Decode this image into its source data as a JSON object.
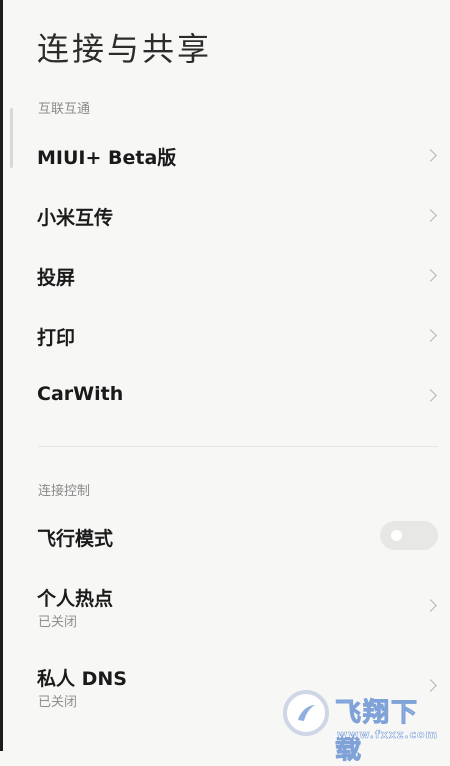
{
  "page": {
    "title": "连接与共享"
  },
  "sections": [
    {
      "header": "互联互通",
      "items": [
        {
          "label": "MIUI+ Beta版"
        },
        {
          "label": "小米互传"
        },
        {
          "label": "投屏"
        },
        {
          "label": "打印"
        },
        {
          "label": "CarWith"
        }
      ]
    },
    {
      "header": "连接控制",
      "items": [
        {
          "label": "飞行模式",
          "toggle": false
        },
        {
          "label": "个人热点",
          "sub": "已关闭"
        },
        {
          "label": "私人 DNS",
          "sub": "已关闭"
        }
      ]
    }
  ],
  "watermark": {
    "text": "飞翔下载",
    "url": "www.fxxz.com"
  }
}
